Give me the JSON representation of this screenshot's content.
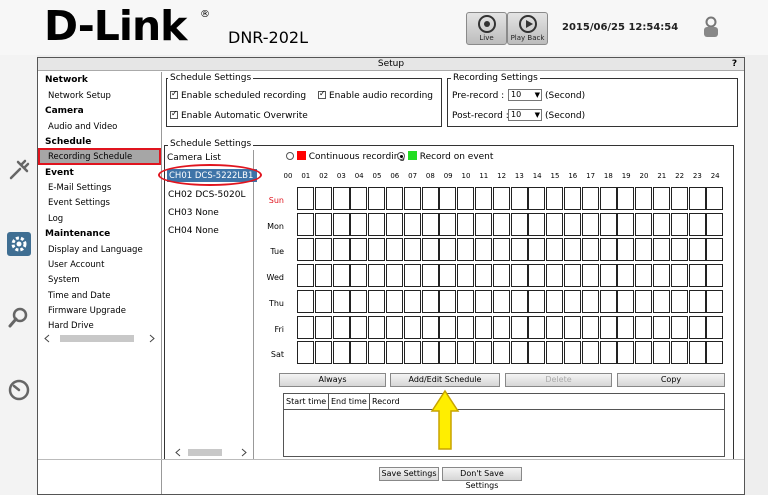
{
  "header": {
    "logo": "D-Link",
    "logo_mark": "®",
    "model": "DNR-202L",
    "live_label": "Live",
    "playback_label": "Play Back",
    "datetime": "2015/06/25 12:54:54"
  },
  "frame": {
    "title": "Setup",
    "help": "?"
  },
  "sidebar": {
    "sections": [
      {
        "heading": "Network",
        "items": [
          "Network Setup"
        ]
      },
      {
        "heading": "Camera",
        "items": [
          "Audio and Video"
        ]
      },
      {
        "heading": "Schedule",
        "items": [
          "Recording Schedule"
        ]
      },
      {
        "heading": "Event",
        "items": [
          "E-Mail Settings",
          "Event Settings",
          "Log"
        ]
      },
      {
        "heading": "Maintenance",
        "items": [
          "Display and Language",
          "User Account",
          "System",
          "Time and Date",
          "Firmware Upgrade",
          "Hard Drive"
        ]
      }
    ],
    "active_item": "Recording Schedule"
  },
  "schedule_settings": {
    "legend": "Schedule Settings",
    "enable_scheduled": "Enable scheduled recording",
    "enable_audio": "Enable audio recording",
    "enable_overwrite": "Enable Automatic Overwrite"
  },
  "recording_settings": {
    "legend": "Recording Settings",
    "pre_label": "Pre-record :",
    "pre_value": "10",
    "post_label": "Post-record :",
    "post_value": "10",
    "unit": "(Second)"
  },
  "schedule_panel": {
    "legend": "Schedule Settings",
    "camera_list_label": "Camera List",
    "cameras": [
      "CH01 DCS-5222LB1",
      "CH02 DCS-5020L",
      "CH03 None",
      "CH04 None"
    ],
    "selected_camera": "CH01 DCS-5222LB1",
    "legend_continuous": "Continuous recording",
    "legend_event": "Record on event",
    "continuous_color": "#ff0000",
    "event_color": "#22dd22",
    "hours": [
      "00",
      "01",
      "02",
      "03",
      "04",
      "05",
      "06",
      "07",
      "08",
      "09",
      "10",
      "11",
      "12",
      "13",
      "14",
      "15",
      "16",
      "17",
      "18",
      "19",
      "20",
      "21",
      "22",
      "23",
      "24"
    ],
    "days": [
      "Sun",
      "Mon",
      "Tue",
      "Wed",
      "Thu",
      "Fri",
      "Sat"
    ],
    "sunday_color": "#e0141e",
    "buttons": {
      "always": "Always",
      "add_edit": "Add/Edit Schedule",
      "delete": "Delete",
      "copy": "Copy"
    },
    "table_headers": [
      "Start time",
      "End time",
      "Record"
    ]
  },
  "footer": {
    "save": "Save Settings",
    "dont_save": "Don't Save Settings"
  },
  "colors": {
    "accent": "#3e74a8",
    "highlight": "#e0141e",
    "arrow": "#ffee00"
  }
}
